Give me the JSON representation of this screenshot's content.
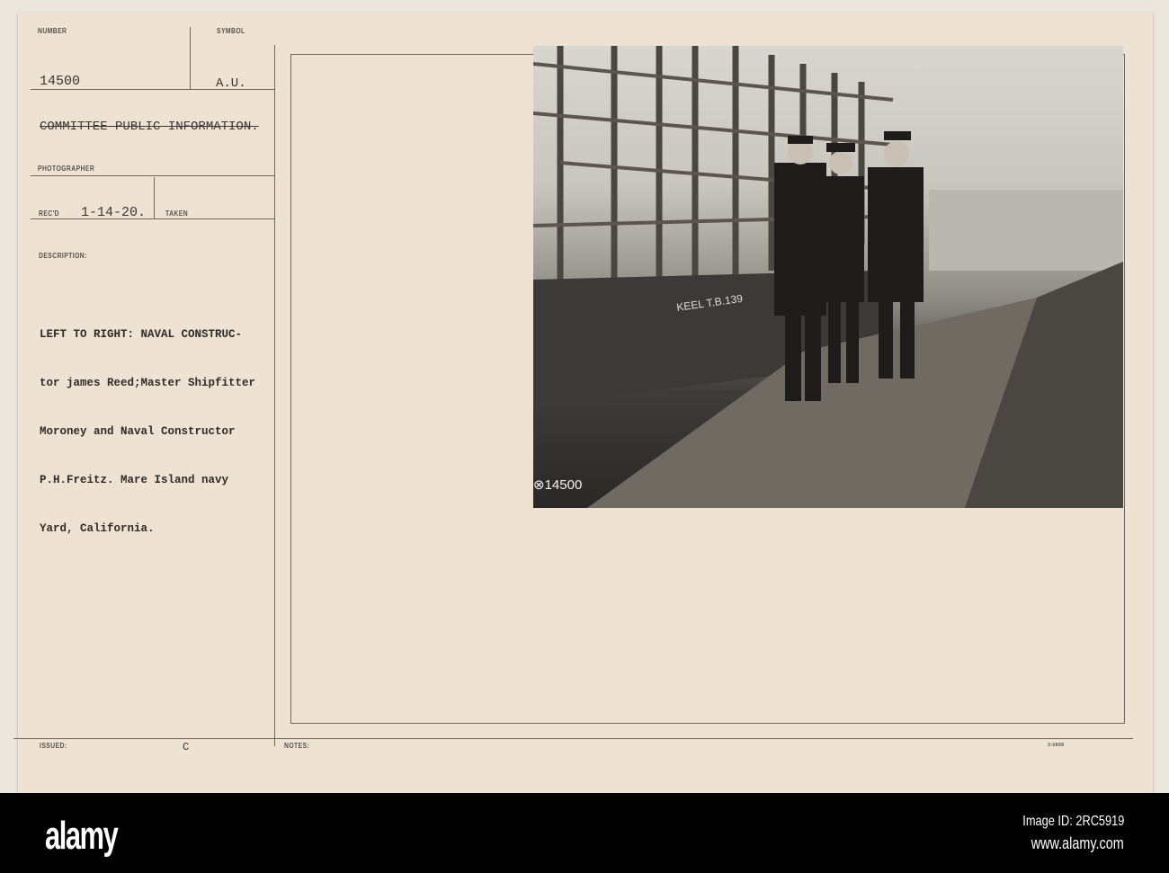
{
  "card": {
    "number_label": "NUMBER",
    "number": "14500",
    "symbol_label": "SYMBOL",
    "symbol": "A.U.",
    "source": "COMMITTEE PUBLIC INFORMATION.",
    "photographer_label": "PHOTOGRAPHER",
    "recd_label": "REC'D",
    "recd": "1-14-20.",
    "taken_label": "TAKEN",
    "description_label": "DESCRIPTION:",
    "description_lines": [
      "LEFT TO RIGHT: NAVAL CONSTRUC-",
      "tor james Reed;Master Shipfitter",
      "Moroney and Naval Constructor",
      "P.H.Freitz. Mare Island navy",
      "Yard, California."
    ],
    "issued_label": "ISSUED:",
    "issued_mark": "C",
    "notes_label": "NOTES:",
    "form_number": "3-5608"
  },
  "photo": {
    "negative_number": "⊗14500",
    "hull_text": "KEEL T.B.139"
  },
  "footer": {
    "logo": "alamy",
    "image_id": "Image ID: 2RC5919",
    "url": "www.alamy.com"
  }
}
